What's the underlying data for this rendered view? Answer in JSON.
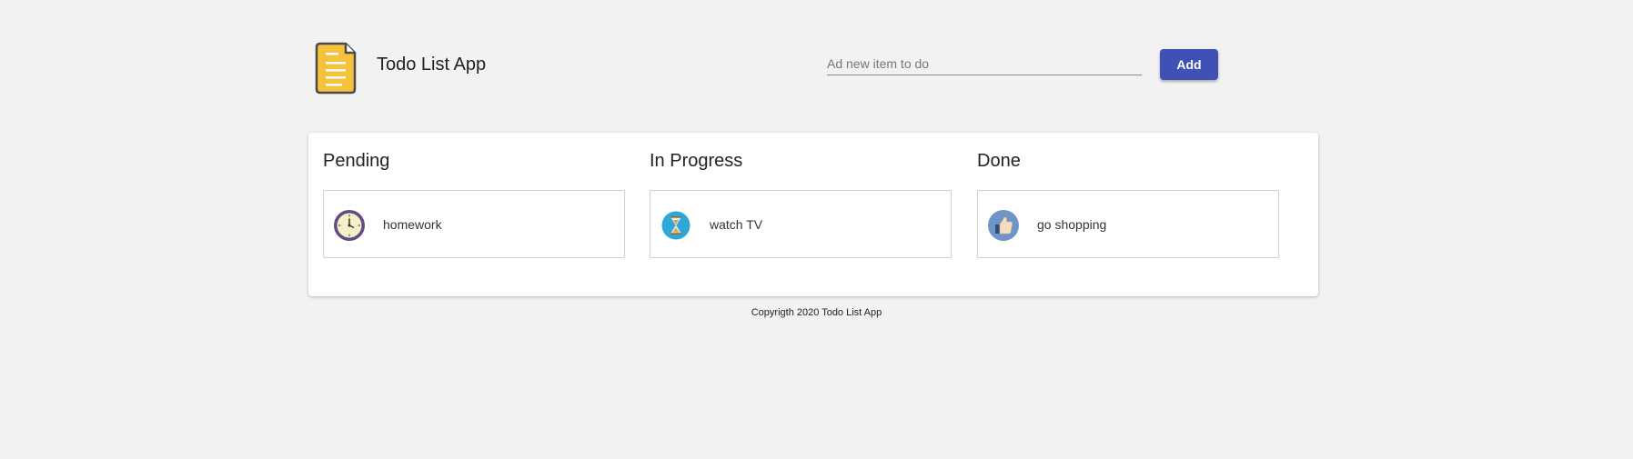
{
  "header": {
    "app_title": "Todo List App",
    "logo_icon": "document-icon",
    "input_placeholder": "Ad new item to do",
    "input_value": "",
    "add_label": "Add"
  },
  "board": {
    "columns": [
      {
        "title": "Pending",
        "items": [
          {
            "label": "homework",
            "icon": "clock-icon"
          }
        ]
      },
      {
        "title": "In Progress",
        "items": [
          {
            "label": "watch TV",
            "icon": "hourglass-icon"
          }
        ]
      },
      {
        "title": "Done",
        "items": [
          {
            "label": "go shopping",
            "icon": "thumbs-up-icon"
          }
        ]
      }
    ]
  },
  "footer": {
    "text": "Copyrigth 2020 Todo List App"
  },
  "colors": {
    "accent": "#3f51b5",
    "background": "#f2f2f2",
    "logo": "#f5c33b"
  }
}
